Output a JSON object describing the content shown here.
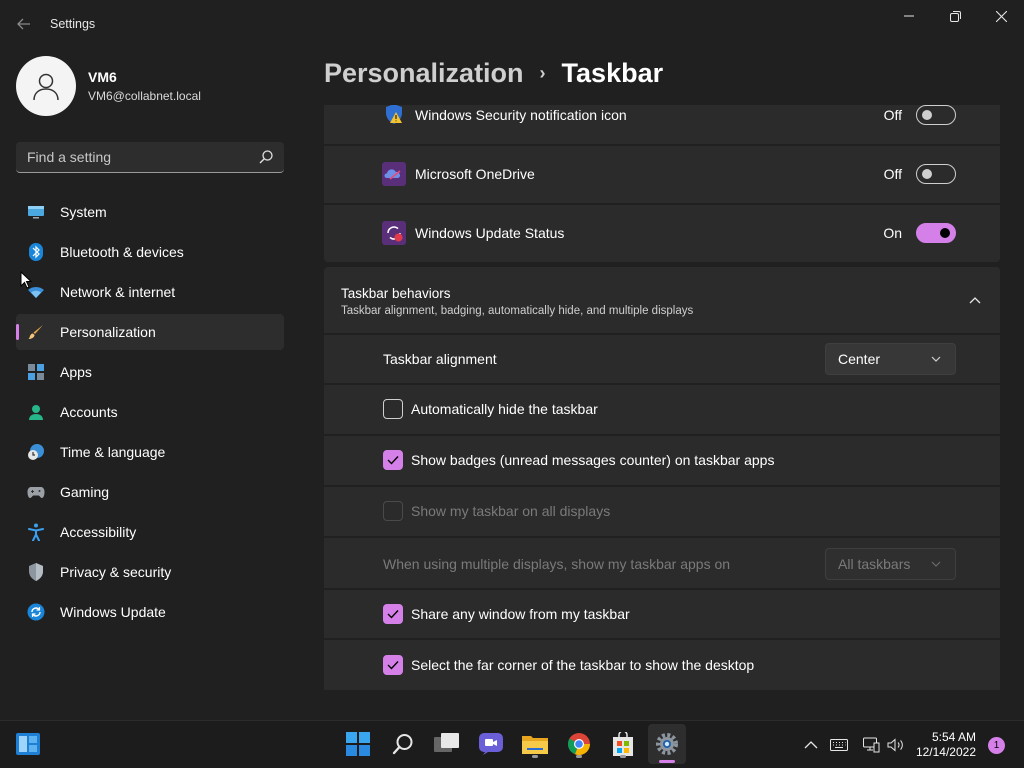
{
  "window": {
    "title": "Settings",
    "controls": [
      "minimize-icon",
      "restore-icon",
      "close-icon"
    ]
  },
  "profile": {
    "name": "VM6",
    "email": "VM6@collabnet.local"
  },
  "search": {
    "placeholder": "Find a setting"
  },
  "sidebar": {
    "items": [
      {
        "label": "System",
        "icon": "monitor-icon"
      },
      {
        "label": "Bluetooth & devices",
        "icon": "bluetooth-icon"
      },
      {
        "label": "Network & internet",
        "icon": "wifi-icon"
      },
      {
        "label": "Personalization",
        "icon": "brush-icon",
        "active": true
      },
      {
        "label": "Apps",
        "icon": "apps-icon"
      },
      {
        "label": "Accounts",
        "icon": "person-icon"
      },
      {
        "label": "Time & language",
        "icon": "clock-globe-icon"
      },
      {
        "label": "Gaming",
        "icon": "gamepad-icon"
      },
      {
        "label": "Accessibility",
        "icon": "accessibility-icon"
      },
      {
        "label": "Privacy & security",
        "icon": "shield-icon"
      },
      {
        "label": "Windows Update",
        "icon": "update-icon"
      }
    ]
  },
  "breadcrumb": {
    "parent": "Personalization",
    "separator": "›",
    "current": "Taskbar"
  },
  "corner_icons": [
    {
      "label": "Windows Security notification icon",
      "state": "Off",
      "on": false,
      "icon": "security-warning-icon"
    },
    {
      "label": "Microsoft OneDrive",
      "state": "Off",
      "on": false,
      "icon": "onedrive-icon"
    },
    {
      "label": "Windows Update Status",
      "state": "On",
      "on": true,
      "icon": "windows-update-status-icon"
    }
  ],
  "behaviors": {
    "title": "Taskbar behaviors",
    "description": "Taskbar alignment, badging, automatically hide, and multiple displays",
    "alignment": {
      "label": "Taskbar alignment",
      "value": "Center"
    },
    "auto_hide": {
      "label": "Automatically hide the taskbar",
      "checked": false
    },
    "badges": {
      "label": "Show badges (unread messages counter) on taskbar apps",
      "checked": true
    },
    "all_displays": {
      "label": "Show my taskbar on all displays",
      "checked": false,
      "disabled": true
    },
    "multi_display": {
      "label": "When using multiple displays, show my taskbar apps on",
      "value": "All taskbars",
      "disabled": true
    },
    "share_window": {
      "label": "Share any window from my taskbar",
      "checked": true
    },
    "far_corner": {
      "label": "Select the far corner of the taskbar to show the desktop",
      "checked": true
    }
  },
  "taskbar": {
    "pinned": [
      "widgets-icon",
      "start-icon",
      "search-icon",
      "task-view-icon",
      "chat-icon",
      "file-explorer-icon",
      "chrome-icon",
      "store-icon",
      "settings-icon"
    ],
    "time": "5:54 AM",
    "date": "12/14/2022",
    "notifications": "1"
  },
  "colors": {
    "accent": "#d580e8",
    "background": "#202020",
    "card": "#2b2b2b"
  }
}
